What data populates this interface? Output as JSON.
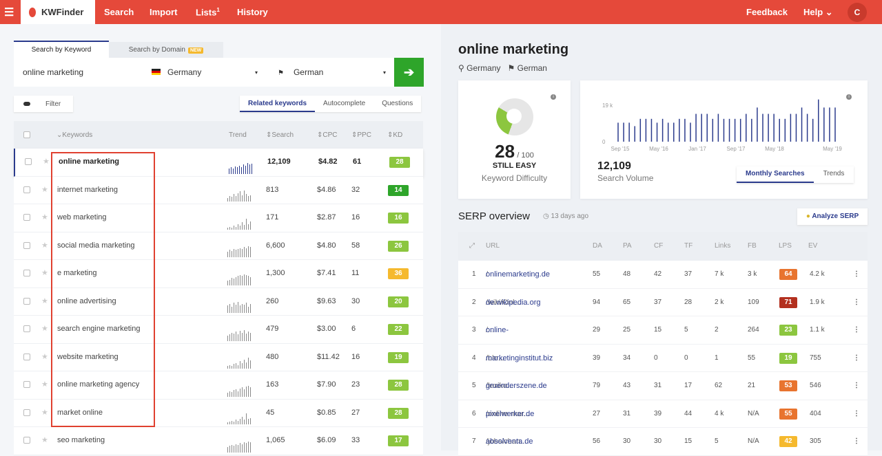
{
  "header": {
    "brand": "KWFinder",
    "nav": [
      "Search",
      "Import",
      "Lists",
      "History"
    ],
    "lists_badge": "1",
    "feedback": "Feedback",
    "help": "Help ⌄",
    "avatar": "C",
    "color": "#e5493a"
  },
  "search": {
    "tab_keyword": "Search by Keyword",
    "tab_domain": "Search by Domain",
    "new_badge": "NEW",
    "query": "online marketing",
    "location": "Germany",
    "language": "German",
    "go_icon": "arrow-right"
  },
  "filter": {
    "label": "Filter"
  },
  "kw_tabs": [
    "Related keywords",
    "Autocomplete",
    "Questions"
  ],
  "table": {
    "headers": {
      "keywords": "Keywords",
      "trend": "Trend",
      "search": "Search",
      "cpc": "CPC",
      "ppc": "PPC",
      "kd": "KD"
    },
    "rows": [
      {
        "keyword": "online marketing",
        "search": "12,109",
        "cpc": "$4.82",
        "ppc": "61",
        "kd": "28",
        "color": "#8cc63f",
        "trend": [
          6,
          7,
          6,
          8,
          7,
          9,
          7,
          10,
          9,
          12,
          10,
          11
        ]
      },
      {
        "keyword": "internet marketing",
        "search": "813",
        "cpc": "$4.86",
        "ppc": "32",
        "kd": "14",
        "color": "#2ea52a",
        "trend": [
          4,
          6,
          5,
          8,
          6,
          9,
          11,
          7,
          12,
          8,
          6,
          7
        ]
      },
      {
        "keyword": "web marketing",
        "search": "171",
        "cpc": "$2.87",
        "ppc": "16",
        "kd": "16",
        "color": "#8cc63f",
        "trend": [
          2,
          3,
          2,
          4,
          3,
          6,
          4,
          8,
          5,
          12,
          6,
          9
        ]
      },
      {
        "keyword": "social media marketing",
        "search": "6,600",
        "cpc": "$4.80",
        "ppc": "58",
        "kd": "26",
        "color": "#8cc63f",
        "trend": [
          6,
          8,
          7,
          9,
          8,
          9,
          10,
          9,
          11,
          10,
          12,
          11
        ]
      },
      {
        "keyword": "e marketing",
        "search": "1,300",
        "cpc": "$7.41",
        "ppc": "11",
        "kd": "36",
        "color": "#f5b92e",
        "trend": [
          5,
          6,
          8,
          7,
          9,
          10,
          11,
          10,
          12,
          11,
          10,
          9
        ]
      },
      {
        "keyword": "online advertising",
        "search": "260",
        "cpc": "$9.63",
        "ppc": "30",
        "kd": "20",
        "color": "#8cc63f",
        "trend": [
          8,
          10,
          7,
          11,
          9,
          12,
          8,
          10,
          9,
          11,
          7,
          10
        ]
      },
      {
        "keyword": "search engine marketing",
        "search": "479",
        "cpc": "$3.00",
        "ppc": "6",
        "kd": "22",
        "color": "#8cc63f",
        "trend": [
          6,
          7,
          9,
          8,
          10,
          7,
          11,
          9,
          12,
          8,
          10,
          9
        ]
      },
      {
        "keyword": "website marketing",
        "search": "480",
        "cpc": "$11.42",
        "ppc": "16",
        "kd": "19",
        "color": "#8cc63f",
        "trend": [
          3,
          4,
          3,
          5,
          6,
          4,
          8,
          6,
          10,
          7,
          12,
          9
        ]
      },
      {
        "keyword": "online marketing agency",
        "search": "163",
        "cpc": "$7.90",
        "ppc": "23",
        "kd": "28",
        "color": "#8cc63f",
        "trend": [
          4,
          6,
          5,
          7,
          8,
          6,
          9,
          10,
          8,
          11,
          12,
          10
        ]
      },
      {
        "keyword": "market online",
        "search": "45",
        "cpc": "$0.85",
        "ppc": "27",
        "kd": "28",
        "color": "#8cc63f",
        "trend": [
          2,
          3,
          4,
          3,
          5,
          4,
          6,
          8,
          5,
          12,
          6,
          7
        ]
      },
      {
        "keyword": "seo marketing",
        "search": "1,065",
        "cpc": "$6.09",
        "ppc": "33",
        "kd": "17",
        "color": "#8cc63f",
        "trend": [
          6,
          7,
          8,
          7,
          9,
          8,
          10,
          9,
          11,
          10,
          12,
          11
        ]
      }
    ]
  },
  "detail": {
    "keyword": "online marketing",
    "location": "Germany",
    "language": "German",
    "kd": {
      "value": "28",
      "max": "/ 100",
      "label": "STILL EASY",
      "caption": "Keyword Difficulty",
      "percent": 28,
      "color": "#8cc63f"
    },
    "volume": {
      "value": "12,109",
      "caption": "Search Volume",
      "tabs": [
        "Monthly Searches",
        "Trends"
      ]
    }
  },
  "chart_data": {
    "type": "bar",
    "y_ticks": [
      "19 k",
      "0"
    ],
    "x_ticks": [
      "Sep '15",
      "May '16",
      "Jan '17",
      "Sep '17",
      "May '18",
      "May '19"
    ],
    "ylim": [
      0,
      19000
    ],
    "values": [
      9900,
      9900,
      9900,
      8100,
      11900,
      11900,
      11900,
      9900,
      11900,
      9900,
      9900,
      11900,
      11900,
      9900,
      14500,
      14500,
      14500,
      11900,
      14500,
      11900,
      11900,
      11900,
      11900,
      14500,
      11900,
      17800,
      14500,
      14500,
      14500,
      11900,
      11900,
      14500,
      14500,
      17800,
      14500,
      11900,
      22000,
      17800,
      17800,
      17800
    ],
    "color": "#2a3a8c"
  },
  "serp": {
    "title": "SERP overview",
    "ago": "13 days ago",
    "analyze": "Analyze SERP",
    "headers": [
      "URL",
      "DA",
      "PA",
      "CF",
      "TF",
      "Links",
      "FB",
      "LPS",
      "EV"
    ],
    "rows": [
      {
        "n": "1",
        "domain": "onlinemarketing.de",
        "path": "/",
        "da": "55",
        "pa": "48",
        "cf": "42",
        "tf": "37",
        "links": "7 k",
        "fb": "3 k",
        "lps": "64",
        "color": "#e8742f",
        "ev": "4.2 k"
      },
      {
        "n": "2",
        "domain": "de.wikipedia.org",
        "path": "/wiki/Onl...",
        "da": "94",
        "pa": "65",
        "cf": "37",
        "tf": "28",
        "links": "2 k",
        "fb": "109",
        "lps": "71",
        "color": "#b3301f",
        "ev": "1.9 k"
      },
      {
        "n": "3",
        "domain": "online-marketing-site.de",
        "path": "/...",
        "da": "29",
        "pa": "25",
        "cf": "15",
        "tf": "5",
        "links": "2",
        "fb": "264",
        "lps": "23",
        "color": "#8cc63f",
        "ev": "1.1 k"
      },
      {
        "n": "4",
        "domain": "marketinginstitut.biz",
        "path": "/blo...",
        "da": "39",
        "pa": "34",
        "cf": "0",
        "tf": "0",
        "links": "1",
        "fb": "55",
        "lps": "19",
        "color": "#8cc63f",
        "ev": "755"
      },
      {
        "n": "5",
        "domain": "gruenderszene.de",
        "path": "/lexiko...",
        "da": "79",
        "pa": "43",
        "cf": "31",
        "tf": "17",
        "links": "62",
        "fb": "21",
        "lps": "53",
        "color": "#e8742f",
        "ev": "546"
      },
      {
        "n": "6",
        "domain": "pixelwerker.de",
        "path": "/online-mar...",
        "da": "27",
        "pa": "31",
        "cf": "39",
        "tf": "44",
        "links": "4 k",
        "fb": "N/A",
        "lps": "55",
        "color": "#e8742f",
        "ev": "404"
      },
      {
        "n": "7",
        "domain": "absolventa.de",
        "path": "/jobs/chan...",
        "da": "56",
        "pa": "30",
        "cf": "30",
        "tf": "15",
        "links": "5",
        "fb": "N/A",
        "lps": "42",
        "color": "#f5b92e",
        "ev": "305"
      }
    ]
  }
}
